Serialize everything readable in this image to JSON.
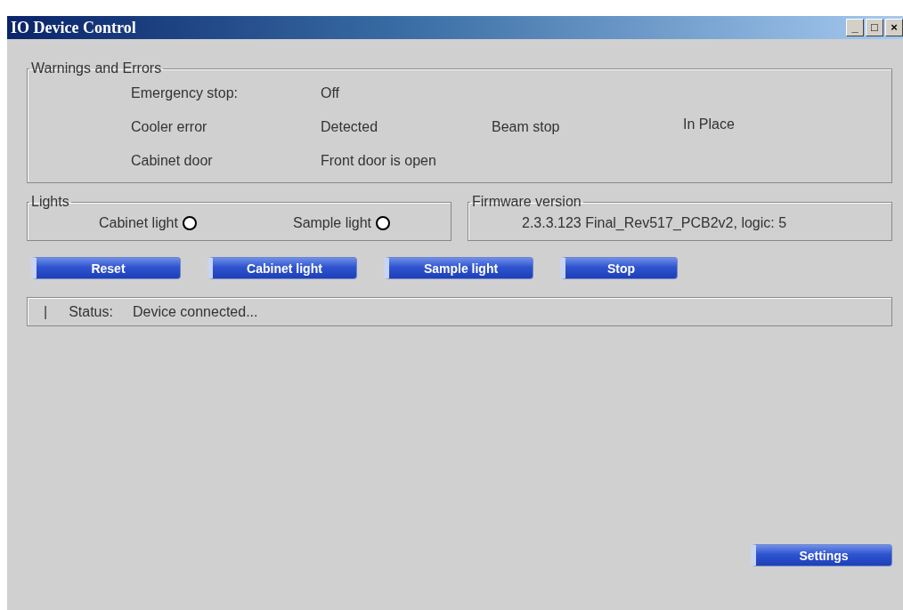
{
  "window": {
    "title": "IO Device Control",
    "controls": [
      "_",
      "□",
      "×"
    ]
  },
  "warnings": {
    "title": "Warnings and Errors",
    "rows": [
      {
        "label": "Emergency stop:",
        "value": "Off"
      },
      {
        "label": "Cooler error",
        "value": "Detected",
        "label_2": "Beam stop",
        "value_2": "In Place"
      },
      {
        "label": "Cabinet door",
        "value": "Front door is open"
      }
    ]
  },
  "lights": {
    "title": "Lights",
    "items": [
      {
        "label": "Cabinet light",
        "on": false
      },
      {
        "label": "Sample light",
        "on": false
      }
    ]
  },
  "firmware": {
    "title": "Firmware version",
    "value": "2.3.3.123 Final_Rev517_PCB2v2, logic: 5"
  },
  "buttons": [
    "Reset",
    "Cabinet light",
    "Sample light",
    "Stop"
  ],
  "status": {
    "separator": "|",
    "label": "Status:",
    "value": "Device connected..."
  },
  "settings_button": "Settings"
}
